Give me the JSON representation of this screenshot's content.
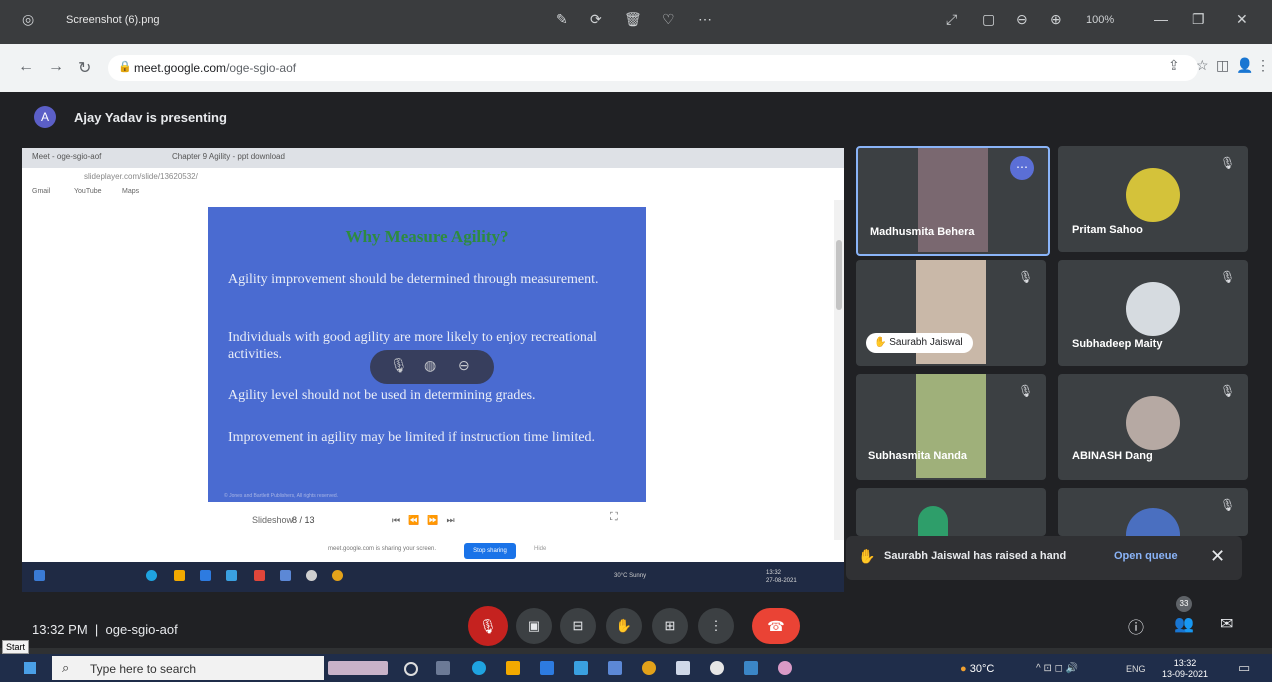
{
  "viewer": {
    "title": "Screenshot (6).png",
    "zoom": "100%",
    "icons": [
      "edit-icon",
      "rotate-icon",
      "delete-icon",
      "heart-icon",
      "more-icon",
      "expand-icon",
      "fit-icon",
      "zoom-out-icon",
      "zoom-in-icon",
      "minimize-icon",
      "restore-icon",
      "close-icon"
    ]
  },
  "browser": {
    "url_host": "meet.google.com",
    "url_path": "/oge-sgio-aof"
  },
  "meet": {
    "presenter_initial": "A",
    "presenting_text": "Ajay Yadav is presenting",
    "meeting_time": "13:32 PM",
    "meeting_code": "oge-sgio-aof",
    "people_count": "33",
    "toast": {
      "message": "Saurabh Jaiswal has raised a hand",
      "action": "Open queue"
    },
    "participants": [
      {
        "name": "Madhusmita Behera"
      },
      {
        "name": "Pritam Sahoo"
      },
      {
        "name": "Saurabh Jaiswal"
      },
      {
        "name": "Subhadeep Maity"
      },
      {
        "name": "Subhasmita Nanda"
      },
      {
        "name": "ABINASH Dang"
      }
    ]
  },
  "shared_screen": {
    "tab1": "Meet - oge-sgio-aof",
    "tab2": "Chapter 9 Agility - ppt download",
    "url": "slideplayer.com/slide/13620532/",
    "bookmarks": [
      "Gmail",
      "YouTube",
      "Maps"
    ],
    "slide": {
      "title": "Why Measure Agility?",
      "bullets": [
        "Agility improvement should be determined through measurement.",
        "Individuals with good agility are more likely to enjoy recreational activities.",
        "Agility level should not be used in determining grades.",
        "Improvement in agility may be limited if instruction time limited."
      ],
      "footer": "© Jones and Bartlett Publishers, All rights reserved."
    },
    "slide_controls": {
      "preview_label": "Slideshow",
      "page": "8 / 13"
    },
    "share_bar": {
      "message": "meet.google.com is sharing your screen.",
      "stop_label": "Stop sharing",
      "hide_label": "Hide"
    },
    "taskbar_weather": "30°C Sunny",
    "taskbar_clock": {
      "time": "13:32",
      "date": "27-08-2021"
    }
  },
  "taskbar": {
    "start_tooltip": "Start",
    "search_placeholder": "Type here to search",
    "weather": "30°C",
    "lang": "ENG",
    "time": "13:32",
    "date": "13-09-2021"
  }
}
